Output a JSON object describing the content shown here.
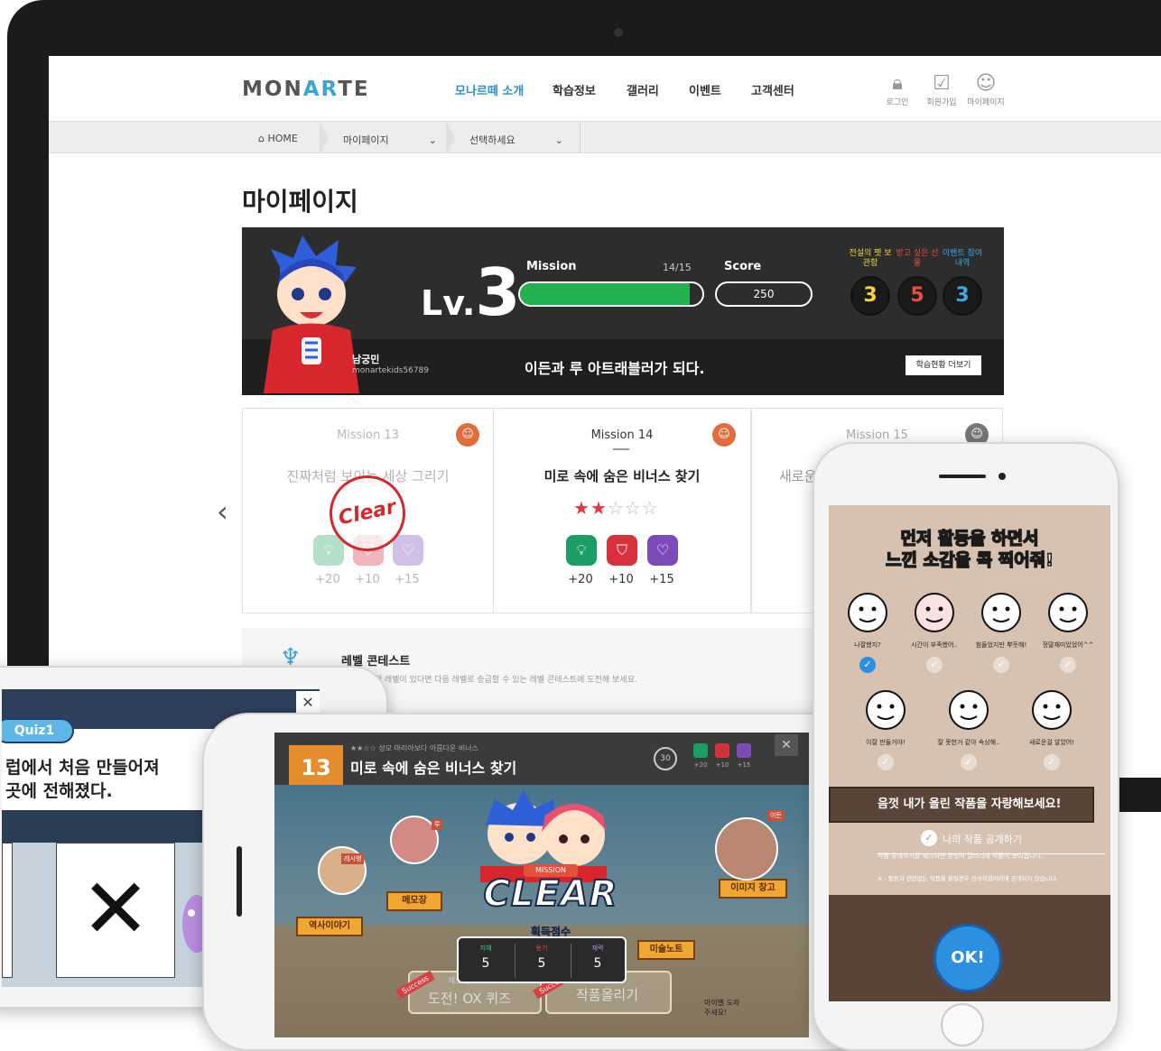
{
  "header": {
    "logo": {
      "pre": "MON",
      "accent": "A",
      "mid": "R",
      "post": "TE"
    },
    "nav": [
      "모나르떼 소개",
      "학습정보",
      "갤러리",
      "이벤트",
      "고객센터"
    ],
    "util": [
      {
        "label": "로그인",
        "icon": "lock-icon"
      },
      {
        "label": "회원가입",
        "icon": "user-check-icon"
      },
      {
        "label": "마이페이지",
        "icon": "user-icon"
      }
    ]
  },
  "breadcrumb": {
    "home": "HOME",
    "sel1": "마이페이지",
    "sel2": "선택하세요"
  },
  "page_title": "마이페이지",
  "profile": {
    "lv_prefix": "Lv.",
    "level": "3",
    "mission_label": "Mission",
    "mission_progress": "14/15",
    "mission_fraction": 0.93,
    "score_label": "Score",
    "score": "250",
    "name": "남궁민",
    "user_id": "monartekids56789",
    "quote": "이든과 루 아트래블러가 되다.",
    "more_button": "학습현황 더보기",
    "counters": [
      {
        "label": "전설의 펫 보관함",
        "value": "3",
        "color": "#f7d534"
      },
      {
        "label": "받고 싶은 선물",
        "value": "5",
        "color": "#e4503a"
      },
      {
        "label": "이벤트 참여 내역",
        "value": "3",
        "color": "#3aa6e6"
      }
    ]
  },
  "missions": [
    {
      "title": "Mission 13",
      "name": "진짜처럼 보이는 세상 그리기",
      "stamp": "Clear",
      "points": [
        "+20",
        "+10",
        "+15"
      ]
    },
    {
      "title": "Mission 14",
      "name": "미로 속에 숨은 비너스 찾기",
      "stars": 2,
      "points": [
        "+20",
        "+10",
        "+15"
      ]
    },
    {
      "title": "Mission 15",
      "name": "새로운"
    }
  ],
  "level_contest": {
    "title": "레벨 콘테스트",
    "desc": "…을 완료한 레벨이 있다면 다음 레벨로 승급할 수 있는 레벨 콘테스트에 도전해 보세요."
  },
  "nav_prev": "‹",
  "quiz_phone": {
    "quiz_label": "Quiz1",
    "text1": "럽에서 처음 만들어져",
    "text2": "곳에 전해졌다.",
    "close": "✕",
    "answer_x": "✕"
  },
  "game_phone": {
    "mission_number": "13",
    "stage_meta": "★★☆☆ 성모 마리아보다 아름다운 비너스",
    "stage_title": "미로 속에 숨은 비너스 찾기",
    "timer": "30",
    "mini_points": [
      "+20",
      "+10",
      "+15"
    ],
    "mission_tag": "MISSION",
    "clear_text": "CLEAR",
    "earned_label": "획득점수",
    "earned": [
      {
        "label": "지혜",
        "value": "5"
      },
      {
        "label": "용기",
        "value": "5"
      },
      {
        "label": "재력",
        "value": "5"
      }
    ],
    "signs": [
      "역사이야기",
      "메모장",
      "이미지 창고",
      "미술노트"
    ],
    "bubbles": [
      "레시앵",
      "루",
      "이든"
    ],
    "bottom": [
      "도전! OX 퀴즈",
      "작품올리기"
    ],
    "bottom_sub": "체크체크",
    "help": "마이벨 도와주세요!",
    "success": "Success"
  },
  "feedback_phone": {
    "title1": "먼저 활동을 하면서",
    "title2a": "느낀 소감을 ",
    "title2b": "콕",
    "title2c": " 찍어줘!",
    "emotions_row1": [
      "나잘했지?",
      "시간이 부족했어..",
      "힘들었지만 뿌듯해!",
      "정말재미있었어^^"
    ],
    "emotions_row2": [
      "이잘 만들거야!",
      "잘 못한거 같아 속상해..",
      "새로운걸 알았어!"
    ],
    "share_banner": "음껏 내가 올린 작품을 자랑해보세요!",
    "share_check": "나의 작품 공개하기",
    "note1": "작품 공개하기를 체크하면 완성작 갤러리에 작품이 보여집니다.",
    "note2": "※ : 활동과 관련없는 작품을 올릴경우 완성작갤러리에 공개되지 않습니다.",
    "ok": "OK!"
  }
}
